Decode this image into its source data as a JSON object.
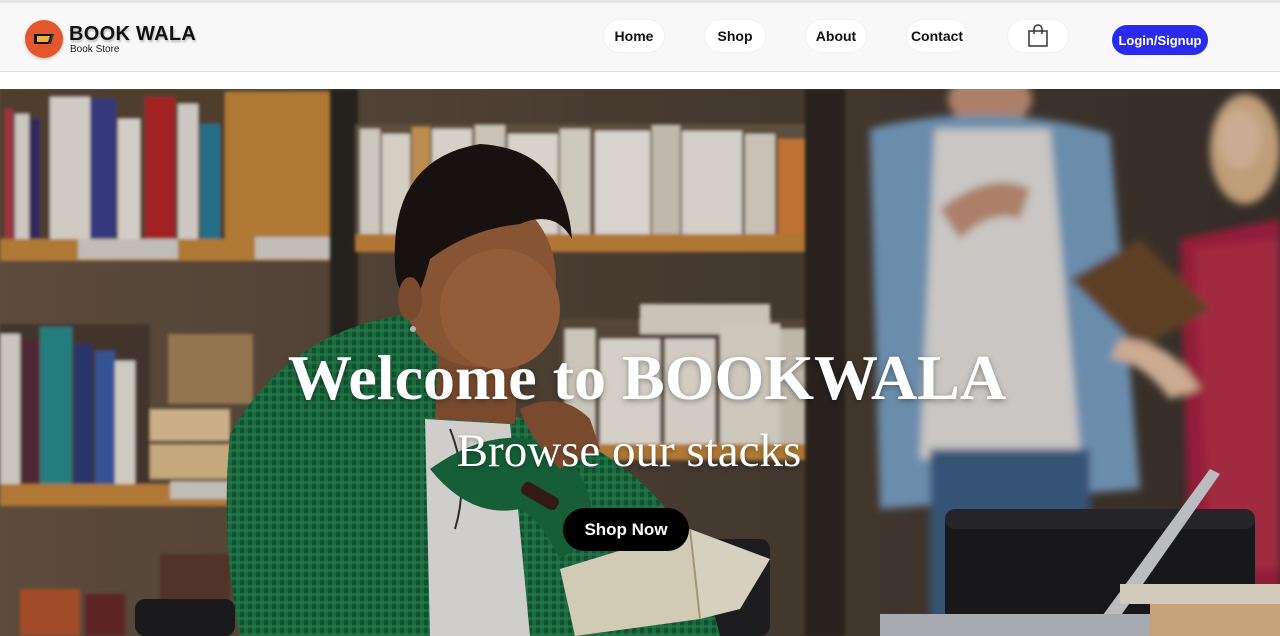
{
  "brand": {
    "title": "BOOK WALA",
    "subtitle": "Book Store",
    "logo_icon": "book-icon",
    "logo_color": "#e4572e"
  },
  "nav": {
    "items": [
      {
        "label": "Home"
      },
      {
        "label": "Shop"
      },
      {
        "label": "About"
      },
      {
        "label": "Contact"
      }
    ],
    "cart_icon": "shopping-bag-icon",
    "login_label": "Login/Signup",
    "login_color": "#2b2bf0"
  },
  "hero": {
    "title": "Welcome to BOOKWALA",
    "subtitle": "Browse our stacks",
    "cta_label": "Shop Now",
    "image": "photo of a young man reading a book in a library with bookshelves and people in background"
  }
}
